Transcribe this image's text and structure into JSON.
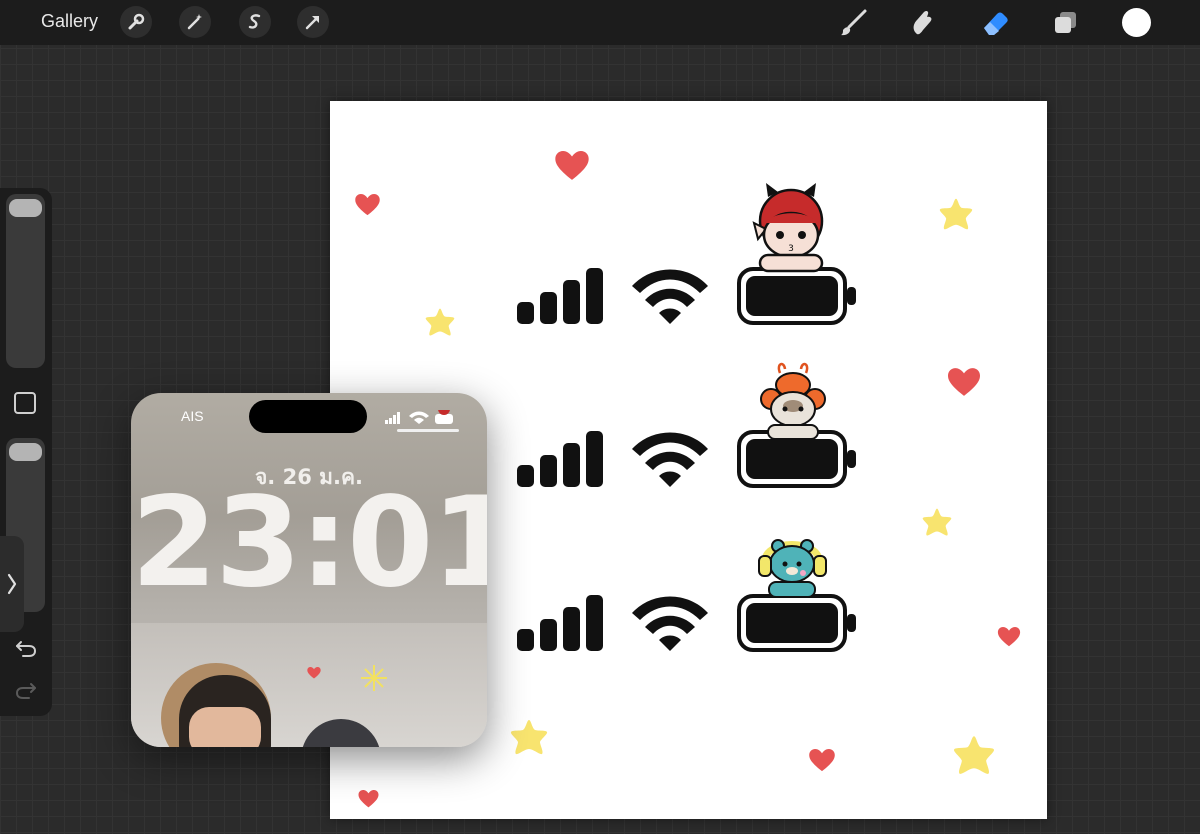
{
  "toolbar": {
    "gallery_label": "Gallery",
    "left_tools": [
      "wrench-icon",
      "magic-wand-icon",
      "selection-icon",
      "transform-arrow-icon"
    ],
    "right_tools": [
      "brush-icon",
      "smudge-icon",
      "eraser-icon",
      "layers-icon"
    ],
    "active_tool": "eraser-icon",
    "current_color": "#ffffff"
  },
  "sidebar": {
    "controls": [
      "brush-size-slider",
      "modify-button",
      "opacity-slider",
      "undo-icon",
      "redo-icon"
    ]
  },
  "phone_preview": {
    "carrier": "AIS",
    "date": "จ. 26 ม.ค.",
    "time": "23:01"
  },
  "colors": {
    "accent_eraser": "#2f8cff",
    "heart": "#e65353",
    "star": "#f8e46f",
    "devil_hair": "#c62b2b"
  }
}
